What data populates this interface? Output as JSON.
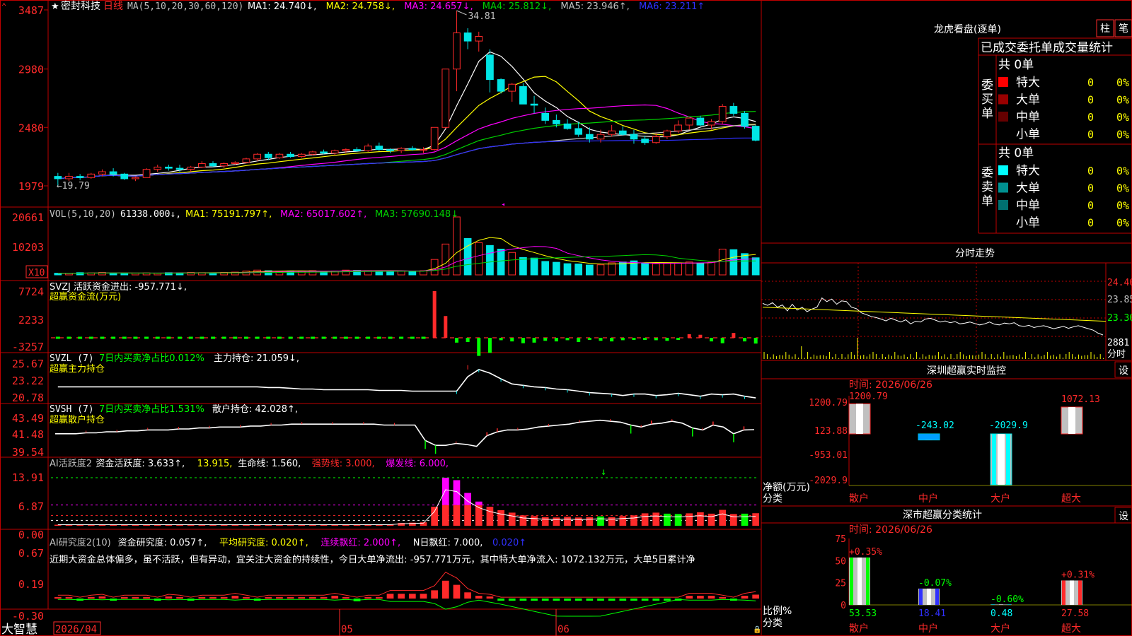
{
  "colors": {
    "up": "#ff2a2a",
    "down": "#00e5e5",
    "frame": "#c00000",
    "white": "#ffffff",
    "yellow": "#ffff00",
    "magenta": "#ff00ff",
    "green": "#00d000",
    "blue": "#3030ff",
    "lime": "#00ff00"
  },
  "main_panel": {
    "star": "★",
    "stock_name": "密封科技",
    "period": "日线",
    "ma_params": "MA(5,10,20,30,60,120)",
    "ma_items": [
      {
        "text": "MA1: 24.740↓,",
        "color": "#ffffff"
      },
      {
        "text": "MA2: 24.758↓,",
        "color": "#ffff00"
      },
      {
        "text": "MA3: 24.657↓,",
        "color": "#ff00ff"
      },
      {
        "text": "MA4: 25.812↓,",
        "color": "#00d000"
      },
      {
        "text": "MA5: 23.946↑,",
        "color": "#c0c0c0"
      },
      {
        "text": "MA6: 23.211↑",
        "color": "#3030ff"
      }
    ],
    "y_labels": [
      "3487",
      "2980",
      "2480",
      "1979"
    ],
    "high_label": "34.81",
    "low_label": "←19.79"
  },
  "vol_panel": {
    "title": "VOL(5,10,20)",
    "value": "61338.000↓,",
    "items": [
      {
        "text": "MA1: 75191.797↑,",
        "color": "#ffff00"
      },
      {
        "text": "MA2: 65017.602↑,",
        "color": "#ff00ff"
      },
      {
        "text": "MA3: 57690.148↓",
        "color": "#00d000"
      }
    ],
    "y_labels": [
      "20661",
      "10203"
    ],
    "unit": "X10"
  },
  "svzj_panel": {
    "line1": "SVZJ  活跃资金进出: -957.771↓,",
    "line2": "超赢资金流(万元)",
    "y_labels": [
      "7724",
      "2233",
      "-3257"
    ]
  },
  "svzl_panel": {
    "prefix": "SVZL (7)",
    "green_text": "7日内买卖净占比0.012%",
    "value_text": "主力持仓: 21.059↓,",
    "line2": "超赢主力持仓",
    "y_labels": [
      "25.67",
      "23.22",
      "20.78"
    ]
  },
  "svsh_panel": {
    "prefix": "SVSH (7)",
    "green_text": "7日内买卖净占比1.531%",
    "value_text": "散户持仓: 42.028↑,",
    "line2": "超赢散户持仓",
    "y_labels": [
      "43.49",
      "41.48",
      "39.54"
    ]
  },
  "ai_active_panel": {
    "items": [
      {
        "text": "AI活跃度2",
        "color": "#c0c0c0"
      },
      {
        "text": "资金活跃度: 3.633↑,",
        "color": "#ffffff"
      },
      {
        "text": "13.915,",
        "color": "#ffff00"
      },
      {
        "text": "生命线: 1.560,",
        "color": "#ffffff"
      },
      {
        "text": "强势线: 3.000,",
        "color": "#ff2a2a"
      },
      {
        "text": "爆发线: 6.000,",
        "color": "#ff00ff"
      }
    ],
    "y_labels": [
      "13.91",
      "6.87",
      "0.00"
    ]
  },
  "ai_research_panel": {
    "items": [
      {
        "text": "AI研究度2(10)",
        "color": "#c0c0c0"
      },
      {
        "text": "资金研究度: 0.057↑,",
        "color": "#ffffff"
      },
      {
        "text": "平均研究度: 0.020↑,",
        "color": "#ffff00"
      },
      {
        "text": "连续飘红: 2.000↑,",
        "color": "#ff00ff"
      },
      {
        "text": "N日飘红: 7.000,",
        "color": "#ffffff"
      },
      {
        "text": "0.020↑",
        "color": "#3030ff"
      }
    ],
    "comment": "近期大资金总体偏多，虽不活跃，但有异动，宜关注大资金的持续性，今日大单净流出: -957.771万元，其中特大单净流入: 1072.132万元，大单5日累计净",
    "y_labels": [
      "0.67",
      "0.19",
      "-0.30"
    ]
  },
  "bottom_bar": {
    "brand": "大智慧",
    "dates": [
      "2026/04",
      "05",
      "06"
    ]
  },
  "dragon_tiger": {
    "title": "龙虎看盘(逐单)",
    "btn_zhu": "柱",
    "btn_bi": "笔",
    "header": "已成交委托单成交量统计",
    "buy_label": "委买单",
    "sell_label": "委卖单",
    "buy_total": "共 0单",
    "sell_total": "共 0单",
    "buy_rows": [
      {
        "label": "特大",
        "swatch": "#ff0000",
        "count": "0",
        "pct": "0%"
      },
      {
        "label": "大单",
        "swatch": "#990000",
        "count": "0",
        "pct": "0%"
      },
      {
        "label": "中单",
        "swatch": "#660000",
        "count": "0",
        "pct": "0%"
      },
      {
        "label": "小单",
        "swatch": "",
        "count": "0",
        "pct": "0%"
      }
    ],
    "sell_rows": [
      {
        "label": "特大",
        "swatch": "#00ffff",
        "count": "0",
        "pct": "0%"
      },
      {
        "label": "大单",
        "swatch": "#009090",
        "count": "0",
        "pct": "0%"
      },
      {
        "label": "中单",
        "swatch": "#007070",
        "count": "0",
        "pct": "0%"
      },
      {
        "label": "小单",
        "swatch": "",
        "count": "0",
        "pct": "0%"
      }
    ]
  },
  "intraday": {
    "title": "分时走势",
    "y_labels": [
      "24.40",
      "23.85",
      "23.30",
      "2881"
    ],
    "vol_unit": "分时"
  },
  "sz_monitor": {
    "title": "深圳超赢实时监控",
    "btn": "设",
    "date_text": "时间: 2026/06/26",
    "y_labels": [
      "1200.79",
      "123.88",
      "-953.01",
      "-2029.9"
    ],
    "axis_caption": [
      "净额(万元)",
      "分类"
    ],
    "categories": [
      "散户",
      "中户",
      "大户",
      "超大"
    ]
  },
  "sz_classify": {
    "title": "深市超赢分类统计",
    "btn": "设",
    "date_text": "时间: 2026/06/26",
    "y_labels": [
      "75",
      "50",
      "25",
      "0"
    ],
    "axis_caption": [
      "比例%",
      "分类"
    ],
    "categories": [
      "散户",
      "中户",
      "大户",
      "超大"
    ]
  },
  "chart_data": [
    {
      "type": "candlestick",
      "title": "密封科技 日线",
      "x_dates": [
        "2026/04",
        "05",
        "06"
      ],
      "ylim": [
        19.79,
        34.87
      ],
      "high": 34.81,
      "low": 19.79,
      "ohlc": [
        [
          20.6,
          20.9,
          19.79,
          20.4
        ],
        [
          20.4,
          20.9,
          20.2,
          20.6
        ],
        [
          20.6,
          20.8,
          20.3,
          20.5
        ],
        [
          20.5,
          20.9,
          20.4,
          20.8
        ],
        [
          20.8,
          21.2,
          20.6,
          21.0
        ],
        [
          21.0,
          21.3,
          20.6,
          20.8
        ],
        [
          20.8,
          20.9,
          20.3,
          20.4
        ],
        [
          20.4,
          20.6,
          20.2,
          20.5
        ],
        [
          20.5,
          21.3,
          20.5,
          21.2
        ],
        [
          21.2,
          21.6,
          21.0,
          21.4
        ],
        [
          21.4,
          21.6,
          21.1,
          21.3
        ],
        [
          21.3,
          21.6,
          21.0,
          21.2
        ],
        [
          21.2,
          21.5,
          21.0,
          21.4
        ],
        [
          21.4,
          21.9,
          21.3,
          21.7
        ],
        [
          21.7,
          21.9,
          21.4,
          21.5
        ],
        [
          21.5,
          21.8,
          21.3,
          21.7
        ],
        [
          21.7,
          21.9,
          21.6,
          21.8
        ],
        [
          21.8,
          22.2,
          21.7,
          22.1
        ],
        [
          22.1,
          22.6,
          21.9,
          22.5
        ],
        [
          22.5,
          22.7,
          22.0,
          22.2
        ],
        [
          22.2,
          22.6,
          22.1,
          22.5
        ],
        [
          22.5,
          22.7,
          22.2,
          22.3
        ],
        [
          22.3,
          22.6,
          22.2,
          22.5
        ],
        [
          22.5,
          22.8,
          22.4,
          22.7
        ],
        [
          22.7,
          22.9,
          22.5,
          22.6
        ],
        [
          22.6,
          22.9,
          22.4,
          22.8
        ],
        [
          22.8,
          23.0,
          22.6,
          22.9
        ],
        [
          22.9,
          23.1,
          22.7,
          22.8
        ],
        [
          22.8,
          23.4,
          22.7,
          23.2
        ],
        [
          23.2,
          23.5,
          22.8,
          22.9
        ],
        [
          22.9,
          23.0,
          22.6,
          22.8
        ],
        [
          22.8,
          23.1,
          22.6,
          23.0
        ],
        [
          23.0,
          23.2,
          22.8,
          22.9
        ],
        [
          22.9,
          23.1,
          22.6,
          22.9
        ],
        [
          22.9,
          24.8,
          22.8,
          24.8
        ],
        [
          24.8,
          29.8,
          24.7,
          29.8
        ],
        [
          29.8,
          34.81,
          27.9,
          32.9
        ],
        [
          32.9,
          33.3,
          31.5,
          32.2
        ],
        [
          32.2,
          33.0,
          31.3,
          32.6
        ],
        [
          31.0,
          31.5,
          27.8,
          28.9
        ],
        [
          28.9,
          29.0,
          27.7,
          27.9
        ],
        [
          27.9,
          28.6,
          27.0,
          28.5
        ],
        [
          28.3,
          28.6,
          26.8,
          26.8
        ],
        [
          26.8,
          27.5,
          26.0,
          26.7
        ],
        [
          26.0,
          26.5,
          25.1,
          25.4
        ],
        [
          25.4,
          25.9,
          24.8,
          25.1
        ],
        [
          25.1,
          25.5,
          24.6,
          24.7
        ],
        [
          24.7,
          25.3,
          24.0,
          24.2
        ],
        [
          24.2,
          24.8,
          23.5,
          23.8
        ],
        [
          23.8,
          24.6,
          23.5,
          24.2
        ],
        [
          24.2,
          25.0,
          24.0,
          24.5
        ],
        [
          24.5,
          24.9,
          24.1,
          24.2
        ],
        [
          24.2,
          24.6,
          23.4,
          23.8
        ],
        [
          23.8,
          24.1,
          23.3,
          23.5
        ],
        [
          23.5,
          24.3,
          23.4,
          24.0
        ],
        [
          24.0,
          24.6,
          23.8,
          24.5
        ],
        [
          24.5,
          25.4,
          24.3,
          25.0
        ],
        [
          25.0,
          25.6,
          24.6,
          25.6
        ],
        [
          25.6,
          25.8,
          24.9,
          25.0
        ],
        [
          25.0,
          25.5,
          24.6,
          25.3
        ],
        [
          25.3,
          26.8,
          25.1,
          26.6
        ],
        [
          26.6,
          26.9,
          25.8,
          26.0
        ],
        [
          26.0,
          26.2,
          24.7,
          24.9
        ],
        [
          24.9,
          25.0,
          23.6,
          23.7
        ]
      ],
      "series": [
        {
          "name": "MA1",
          "color": "#ffffff"
        },
        {
          "name": "MA2",
          "color": "#ffff00"
        },
        {
          "name": "MA3",
          "color": "#ff00ff"
        },
        {
          "name": "MA4",
          "color": "#00d000"
        },
        {
          "name": "MA5",
          "color": "#c0c0c0"
        },
        {
          "name": "MA6",
          "color": "#3030ff"
        }
      ]
    },
    {
      "type": "bar",
      "title": "VOL(5,10,20)",
      "ylim": [
        0,
        20661
      ],
      "values": [
        600,
        500,
        800,
        700,
        900,
        600,
        500,
        600,
        700,
        600,
        800,
        700,
        900,
        800,
        700,
        900,
        1000,
        1400,
        1700,
        1500,
        1300,
        1400,
        1300,
        1500,
        1200,
        1400,
        1700,
        1600,
        1500,
        1400,
        1300,
        1400,
        1200,
        1500,
        5500,
        11000,
        20661,
        13000,
        11500,
        10500,
        9200,
        8000,
        6200,
        6000,
        4800,
        4500,
        4000,
        3900,
        3500,
        3600,
        4300,
        4600,
        5000,
        4200,
        4000,
        4100,
        4300,
        4600,
        4200,
        4500,
        9200,
        9000,
        7600,
        6100
      ]
    },
    {
      "type": "bar",
      "title": "SVZJ 活跃资金进出",
      "ylim": [
        -3257,
        7724
      ],
      "values": [
        0,
        0,
        0,
        0,
        0,
        0,
        0,
        0,
        0,
        0,
        0,
        0,
        0,
        0,
        0,
        0,
        0,
        0,
        0,
        0,
        0,
        0,
        0,
        0,
        0,
        0,
        0,
        0,
        0,
        0,
        0,
        0,
        0,
        0,
        7724,
        3600,
        -800,
        -700,
        -3000,
        -2500,
        -400,
        -600,
        -900,
        -800,
        -500,
        -600,
        -400,
        -700,
        -300,
        -500,
        -600,
        -400,
        -300,
        -200,
        -400,
        -500,
        -300,
        600,
        500,
        -600,
        -900,
        800,
        -600,
        -957.771
      ]
    },
    {
      "type": "line",
      "title": "SVZL 主力持仓",
      "ylim": [
        20.78,
        25.67
      ],
      "values": [
        22.6,
        22.6,
        22.6,
        22.6,
        22.6,
        22.6,
        22.6,
        22.6,
        22.6,
        22.6,
        22.6,
        22.6,
        22.6,
        22.6,
        22.6,
        22.6,
        22.6,
        22.6,
        22.6,
        22.5,
        22.5,
        22.4,
        22.3,
        22.3,
        22.2,
        22.2,
        22.2,
        22.2,
        22.2,
        22.1,
        22.1,
        22.1,
        22.0,
        22.0,
        22.0,
        22.0,
        22.0,
        24.0,
        25.0,
        24.5,
        23.7,
        23.0,
        22.8,
        22.6,
        22.5,
        22.3,
        22.2,
        22.0,
        21.8,
        21.7,
        21.6,
        21.4,
        21.6,
        21.6,
        21.4,
        21.5,
        21.7,
        21.5,
        21.3,
        21.6,
        21.5,
        21.6,
        21.3,
        21.059
      ]
    },
    {
      "type": "line",
      "title": "SVSH 散户持仓",
      "ylim": [
        39.54,
        43.49
      ],
      "values": [
        41.6,
        41.6,
        41.6,
        41.7,
        41.7,
        41.8,
        41.8,
        41.9,
        41.9,
        42.0,
        42.0,
        42.0,
        42.1,
        42.1,
        42.2,
        42.2,
        42.3,
        42.3,
        42.3,
        42.4,
        42.4,
        42.5,
        42.5,
        42.6,
        42.6,
        42.6,
        42.6,
        42.6,
        42.6,
        42.6,
        42.6,
        42.6,
        42.5,
        42.5,
        42.5,
        42.5,
        40.9,
        40.4,
        40.4,
        40.6,
        40.5,
        40.3,
        41.4,
        41.8,
        42.0,
        42.0,
        42.1,
        42.3,
        42.4,
        42.5,
        42.6,
        42.8,
        42.9,
        43.0,
        42.9,
        42.8,
        42.5,
        42.3,
        42.6,
        42.7,
        42.9,
        42.7,
        42.2,
        42.0,
        42.5,
        42.3,
        41.6,
        42.0,
        42.028
      ]
    },
    {
      "type": "bar",
      "title": "AI活跃度2",
      "ylim": [
        0,
        13.91
      ],
      "values": [
        0.3,
        0.2,
        0.3,
        0.2,
        0.3,
        0.2,
        0.2,
        0.3,
        0.3,
        0.2,
        0.3,
        0.2,
        0.3,
        0.2,
        0.2,
        0.3,
        0.2,
        0.3,
        0.4,
        0.3,
        0.3,
        0.2,
        0.3,
        0.2,
        0.3,
        0.3,
        0.4,
        0.3,
        0.3,
        0.3,
        0.3,
        0.8,
        0.9,
        1.0,
        5.5,
        13.91,
        13.2,
        9.5,
        7.0,
        5.5,
        4.5,
        3.8,
        3.0,
        2.8,
        2.5,
        2.4,
        2.6,
        2.4,
        2.5,
        2.7,
        2.5,
        2.8,
        3.0,
        3.6,
        3.8,
        3.5,
        3.4,
        3.6,
        3.9,
        3.5,
        4.6,
        3.4,
        3.5,
        3.633
      ],
      "green_idx": [
        38,
        49,
        55,
        56,
        62
      ]
    },
    {
      "type": "bar",
      "title": "AI研究度2(10)",
      "ylim": [
        -0.3,
        0.67
      ],
      "values": [
        0.02,
        0.02,
        -0.03,
        0.02,
        0.03,
        -0.02,
        0.02,
        0.02,
        0.02,
        -0.02,
        0.03,
        0.02,
        -0.03,
        0.02,
        0.02,
        0.02,
        0.04,
        0.02,
        -0.03,
        0.02,
        0.02,
        0.02,
        0.02,
        0.02,
        0.02,
        0.04,
        0.02,
        -0.04,
        0.02,
        0.02,
        0.07,
        0.07,
        0.07,
        0.07,
        0.12,
        0.26,
        0.2,
        0.09,
        0.04,
        0.03,
        -0.02,
        -0.02,
        -0.02,
        -0.02,
        -0.02,
        -0.02,
        -0.02,
        -0.02,
        -0.02,
        -0.02,
        -0.02,
        -0.02,
        -0.02,
        -0.02,
        -0.02,
        -0.02,
        -0.02,
        0.04,
        0.04,
        0.04,
        0.02,
        -0.03,
        0.04,
        0.057
      ]
    },
    {
      "type": "bar",
      "title": "深圳超赢实时监控",
      "categories": [
        "散户",
        "中户",
        "大户",
        "超大"
      ],
      "values": [
        1200.79,
        -243.02,
        -2029.9,
        1072.13
      ],
      "ylim": [
        -2029.9,
        1200.79
      ]
    },
    {
      "type": "bar",
      "title": "深市超赢分类统计",
      "categories": [
        "散户",
        "中户",
        "大户",
        "超大"
      ],
      "values": [
        53.53,
        18.41,
        0.48,
        27.58
      ],
      "changes": [
        "+0.35%",
        "-0.07%",
        "-0.60%",
        "+0.31%"
      ],
      "ylim": [
        0,
        75
      ]
    },
    {
      "type": "line",
      "title": "分时走势",
      "ylim": [
        22.75,
        24.4
      ],
      "values": [
        23.8,
        23.75,
        23.82,
        23.7,
        23.76,
        23.6,
        23.78,
        23.62,
        23.7,
        23.58,
        23.65,
        23.7,
        23.95,
        23.85,
        23.92,
        23.78,
        23.87,
        23.85,
        23.7,
        23.66,
        23.55,
        23.5,
        23.45,
        23.42,
        23.38,
        23.33,
        23.4,
        23.35,
        23.3,
        23.36,
        23.25,
        23.32,
        23.3,
        23.38,
        23.4,
        23.35,
        23.3,
        23.33,
        23.28,
        23.31,
        23.25,
        23.27,
        23.3,
        23.26,
        23.22,
        23.25,
        23.3,
        23.24,
        23.22,
        23.27,
        23.25,
        23.28,
        23.2,
        23.18,
        23.21,
        23.15,
        23.18,
        23.2,
        23.16,
        23.12,
        23.15,
        23.18,
        23.13,
        23.17,
        23.2,
        23.16,
        23.12,
        23.08,
        23.0,
        22.95
      ]
    }
  ]
}
